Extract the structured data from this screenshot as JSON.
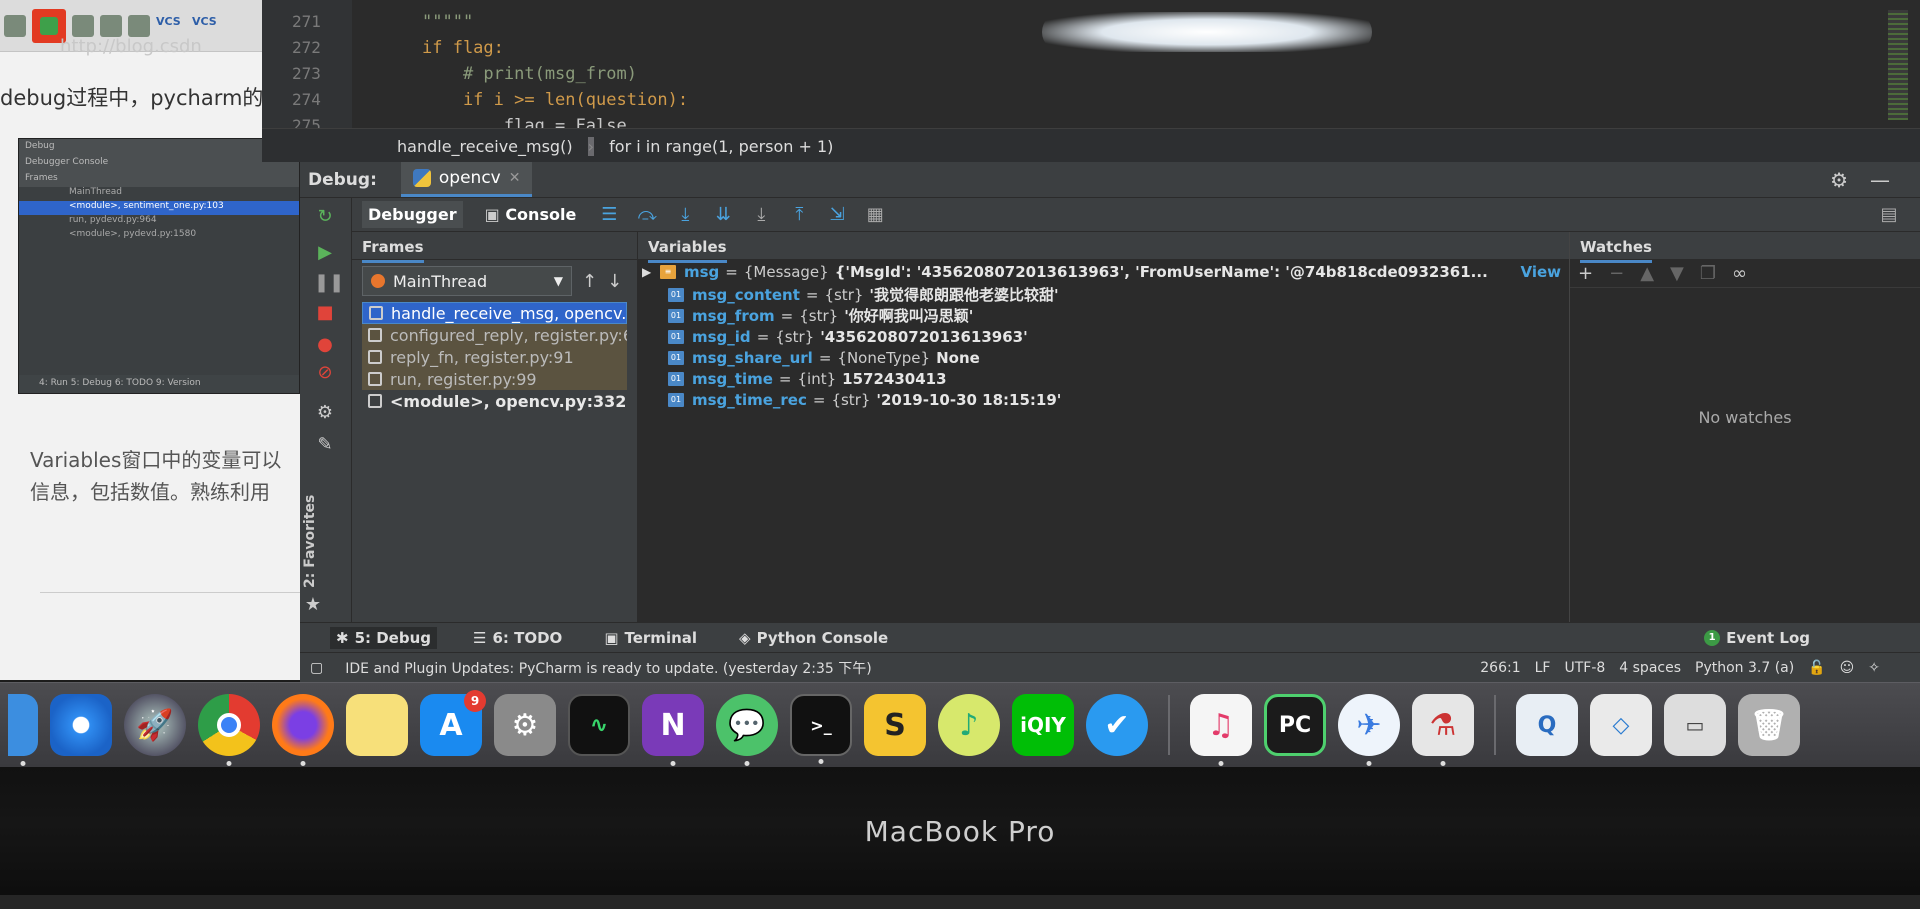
{
  "blog": {
    "url_text": "http://blog.csdn",
    "vcs1": "VCS",
    "vcs2": "VCS",
    "line1": "debug过程中，pycharm的",
    "thumb_title": "Debug",
    "thumb_tabs": "Debugger  Console",
    "thumb_frames": "Frames",
    "thumb_thread": "MainThread",
    "thumb_rows": [
      "<module>, sentiment_one.py:103",
      "run, pydevd.py:964",
      "<module>, pydevd.py:1580"
    ],
    "thumb_bottom": "4: Run   5: Debug   6: TODO   9: Version",
    "para1": "Variables窗口中的变量可以",
    "para2": "信息，包括数值。熟练利用"
  },
  "editor": {
    "lines": [
      {
        "num": "271",
        "code": "\"\"\"\"\"",
        "cls": "cm"
      },
      {
        "num": "272",
        "code": "if flag:",
        "cls": "kw"
      },
      {
        "num": "273",
        "code": "    # print(msg_from)",
        "cls": "cm"
      },
      {
        "num": "274",
        "code": "    if i >= len(question):",
        "cls": "kw"
      },
      {
        "num": "275",
        "code": "        flag = False",
        "cls": "tx"
      }
    ],
    "breadcrumb": [
      "handle_receive_msg()",
      "for i in range(1, person + 1)"
    ]
  },
  "debug": {
    "title": "Debug:",
    "tab_label": "opencv",
    "tab_close": "✕",
    "toolbar": {
      "debugger": "Debugger",
      "console": "Console"
    },
    "frames": {
      "header": "Frames",
      "thread": "MainThread",
      "items": [
        {
          "label": "handle_receive_msg, opencv.py:",
          "kind": "sel"
        },
        {
          "label": "configured_reply, register.py:6",
          "kind": "lib"
        },
        {
          "label": "reply_fn, register.py:91",
          "kind": "lib"
        },
        {
          "label": "run, register.py:99",
          "kind": "lib"
        },
        {
          "label": "<module>, opencv.py:332",
          "kind": "plain"
        }
      ]
    },
    "variables": {
      "header": "Variables",
      "items": [
        {
          "name": "msg",
          "type": "{Message}",
          "value": "{'MsgId': '4356208072013613963', 'FromUserName': '@74b818cde0932361...",
          "view": "View",
          "top": true
        },
        {
          "name": "msg_content",
          "type": "{str}",
          "value": "'我觉得郎朗跟他老婆比较甜'"
        },
        {
          "name": "msg_from",
          "type": "{str}",
          "value": "'你好啊我叫冯思颖'"
        },
        {
          "name": "msg_id",
          "type": "{str}",
          "value": "'4356208072013613963'"
        },
        {
          "name": "msg_share_url",
          "type": "{NoneType}",
          "value": "None"
        },
        {
          "name": "msg_time",
          "type": "{int}",
          "value": "1572430413"
        },
        {
          "name": "msg_time_rec",
          "type": "{str}",
          "value": "'2019-10-30 18:15:19'"
        }
      ]
    },
    "watches": {
      "header": "Watches",
      "empty": "No watches"
    },
    "favorites": "2: Favorites",
    "bottom_tabs": {
      "debug": "5: Debug",
      "todo": "6: TODO",
      "terminal": "Terminal",
      "pyconsole": "Python Console",
      "eventlog": "Event Log"
    },
    "status": {
      "message": "IDE and Plugin Updates: PyCharm is ready to update. (yesterday 2:35 下午)",
      "position": "266:1",
      "line_sep": "LF",
      "encoding": "UTF-8",
      "indent": "4 spaces",
      "interpreter": "Python 3.7 (a)"
    }
  },
  "dock": {
    "appstore_badge": "9",
    "pycharm_label": "PC",
    "qiyi_label": "iQIY"
  },
  "bezel": {
    "label": "MacBook Pro"
  },
  "colors": {
    "accent": "#4a88c7",
    "selection": "#2f65ca",
    "var_name": "#4aa3df",
    "lib_frame": "#5b5340"
  }
}
